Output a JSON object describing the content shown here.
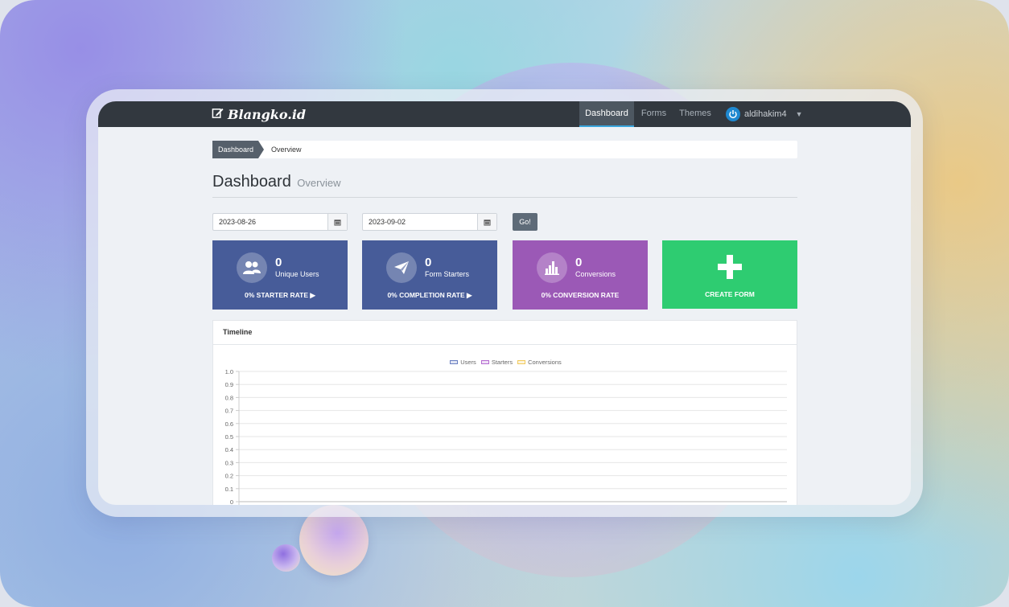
{
  "app": {
    "brand": "Blangko.id"
  },
  "nav": {
    "items": [
      {
        "label": "Dashboard",
        "active": true
      },
      {
        "label": "Forms",
        "active": false
      },
      {
        "label": "Themes",
        "active": false
      }
    ],
    "user": {
      "name": "aldihakim4"
    }
  },
  "breadcrumb": {
    "parent": "Dashboard",
    "current": "Overview"
  },
  "header": {
    "title": "Dashboard",
    "subtitle": "Overview"
  },
  "filters": {
    "start_date": "2023-08-26",
    "end_date": "2023-09-02",
    "go_label": "Go!"
  },
  "stats": [
    {
      "value": "0",
      "label": "Unique Users",
      "rate": "0% STARTER RATE",
      "color": "#475c99",
      "icon": "users-icon"
    },
    {
      "value": "0",
      "label": "Form Starters",
      "rate": "0% COMPLETION RATE",
      "color": "#475c99",
      "icon": "paper-plane-icon"
    },
    {
      "value": "0",
      "label": "Conversions",
      "rate": "0% CONVERSION RATE",
      "color": "#9b59b6",
      "icon": "bar-chart-icon"
    }
  ],
  "create": {
    "label": "CREATE FORM",
    "color": "#2ecc71"
  },
  "timeline": {
    "title": "Timeline"
  },
  "chart_data": {
    "type": "line",
    "title": "",
    "legend_position": "top",
    "series": [
      {
        "name": "Users",
        "color": "#6a7fc1",
        "values": []
      },
      {
        "name": "Starters",
        "color": "#b46bd0",
        "values": []
      },
      {
        "name": "Conversions",
        "color": "#f1c95c",
        "values": []
      }
    ],
    "ylim": [
      0,
      1.0
    ],
    "yticks": [
      "1.0",
      "0.9",
      "0.8",
      "0.7",
      "0.6",
      "0.5",
      "0.4",
      "0.3",
      "0.2",
      "0.1",
      "0"
    ],
    "grid": true
  }
}
